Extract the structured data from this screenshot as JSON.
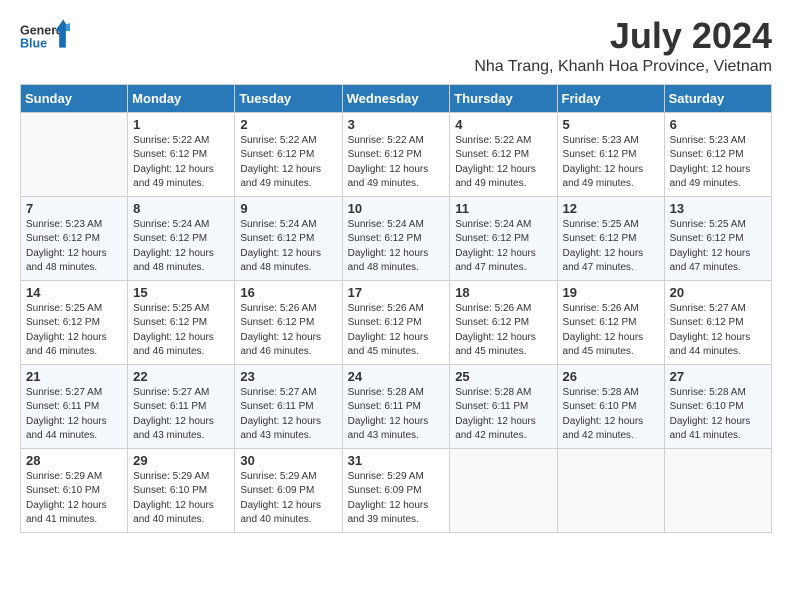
{
  "header": {
    "logo_general": "General",
    "logo_blue": "Blue",
    "month_title": "July 2024",
    "location": "Nha Trang, Khanh Hoa Province, Vietnam"
  },
  "days_of_week": [
    "Sunday",
    "Monday",
    "Tuesday",
    "Wednesday",
    "Thursday",
    "Friday",
    "Saturday"
  ],
  "weeks": [
    [
      {
        "day": "",
        "info": ""
      },
      {
        "day": "1",
        "info": "Sunrise: 5:22 AM\nSunset: 6:12 PM\nDaylight: 12 hours and 49 minutes."
      },
      {
        "day": "2",
        "info": "Sunrise: 5:22 AM\nSunset: 6:12 PM\nDaylight: 12 hours and 49 minutes."
      },
      {
        "day": "3",
        "info": "Sunrise: 5:22 AM\nSunset: 6:12 PM\nDaylight: 12 hours and 49 minutes."
      },
      {
        "day": "4",
        "info": "Sunrise: 5:22 AM\nSunset: 6:12 PM\nDaylight: 12 hours and 49 minutes."
      },
      {
        "day": "5",
        "info": "Sunrise: 5:23 AM\nSunset: 6:12 PM\nDaylight: 12 hours and 49 minutes."
      },
      {
        "day": "6",
        "info": "Sunrise: 5:23 AM\nSunset: 6:12 PM\nDaylight: 12 hours and 49 minutes."
      }
    ],
    [
      {
        "day": "7",
        "info": "Sunrise: 5:23 AM\nSunset: 6:12 PM\nDaylight: 12 hours and 48 minutes."
      },
      {
        "day": "8",
        "info": "Sunrise: 5:24 AM\nSunset: 6:12 PM\nDaylight: 12 hours and 48 minutes."
      },
      {
        "day": "9",
        "info": "Sunrise: 5:24 AM\nSunset: 6:12 PM\nDaylight: 12 hours and 48 minutes."
      },
      {
        "day": "10",
        "info": "Sunrise: 5:24 AM\nSunset: 6:12 PM\nDaylight: 12 hours and 48 minutes."
      },
      {
        "day": "11",
        "info": "Sunrise: 5:24 AM\nSunset: 6:12 PM\nDaylight: 12 hours and 47 minutes."
      },
      {
        "day": "12",
        "info": "Sunrise: 5:25 AM\nSunset: 6:12 PM\nDaylight: 12 hours and 47 minutes."
      },
      {
        "day": "13",
        "info": "Sunrise: 5:25 AM\nSunset: 6:12 PM\nDaylight: 12 hours and 47 minutes."
      }
    ],
    [
      {
        "day": "14",
        "info": "Sunrise: 5:25 AM\nSunset: 6:12 PM\nDaylight: 12 hours and 46 minutes."
      },
      {
        "day": "15",
        "info": "Sunrise: 5:25 AM\nSunset: 6:12 PM\nDaylight: 12 hours and 46 minutes."
      },
      {
        "day": "16",
        "info": "Sunrise: 5:26 AM\nSunset: 6:12 PM\nDaylight: 12 hours and 46 minutes."
      },
      {
        "day": "17",
        "info": "Sunrise: 5:26 AM\nSunset: 6:12 PM\nDaylight: 12 hours and 45 minutes."
      },
      {
        "day": "18",
        "info": "Sunrise: 5:26 AM\nSunset: 6:12 PM\nDaylight: 12 hours and 45 minutes."
      },
      {
        "day": "19",
        "info": "Sunrise: 5:26 AM\nSunset: 6:12 PM\nDaylight: 12 hours and 45 minutes."
      },
      {
        "day": "20",
        "info": "Sunrise: 5:27 AM\nSunset: 6:12 PM\nDaylight: 12 hours and 44 minutes."
      }
    ],
    [
      {
        "day": "21",
        "info": "Sunrise: 5:27 AM\nSunset: 6:11 PM\nDaylight: 12 hours and 44 minutes."
      },
      {
        "day": "22",
        "info": "Sunrise: 5:27 AM\nSunset: 6:11 PM\nDaylight: 12 hours and 43 minutes."
      },
      {
        "day": "23",
        "info": "Sunrise: 5:27 AM\nSunset: 6:11 PM\nDaylight: 12 hours and 43 minutes."
      },
      {
        "day": "24",
        "info": "Sunrise: 5:28 AM\nSunset: 6:11 PM\nDaylight: 12 hours and 43 minutes."
      },
      {
        "day": "25",
        "info": "Sunrise: 5:28 AM\nSunset: 6:11 PM\nDaylight: 12 hours and 42 minutes."
      },
      {
        "day": "26",
        "info": "Sunrise: 5:28 AM\nSunset: 6:10 PM\nDaylight: 12 hours and 42 minutes."
      },
      {
        "day": "27",
        "info": "Sunrise: 5:28 AM\nSunset: 6:10 PM\nDaylight: 12 hours and 41 minutes."
      }
    ],
    [
      {
        "day": "28",
        "info": "Sunrise: 5:29 AM\nSunset: 6:10 PM\nDaylight: 12 hours and 41 minutes."
      },
      {
        "day": "29",
        "info": "Sunrise: 5:29 AM\nSunset: 6:10 PM\nDaylight: 12 hours and 40 minutes."
      },
      {
        "day": "30",
        "info": "Sunrise: 5:29 AM\nSunset: 6:09 PM\nDaylight: 12 hours and 40 minutes."
      },
      {
        "day": "31",
        "info": "Sunrise: 5:29 AM\nSunset: 6:09 PM\nDaylight: 12 hours and 39 minutes."
      },
      {
        "day": "",
        "info": ""
      },
      {
        "day": "",
        "info": ""
      },
      {
        "day": "",
        "info": ""
      }
    ]
  ]
}
